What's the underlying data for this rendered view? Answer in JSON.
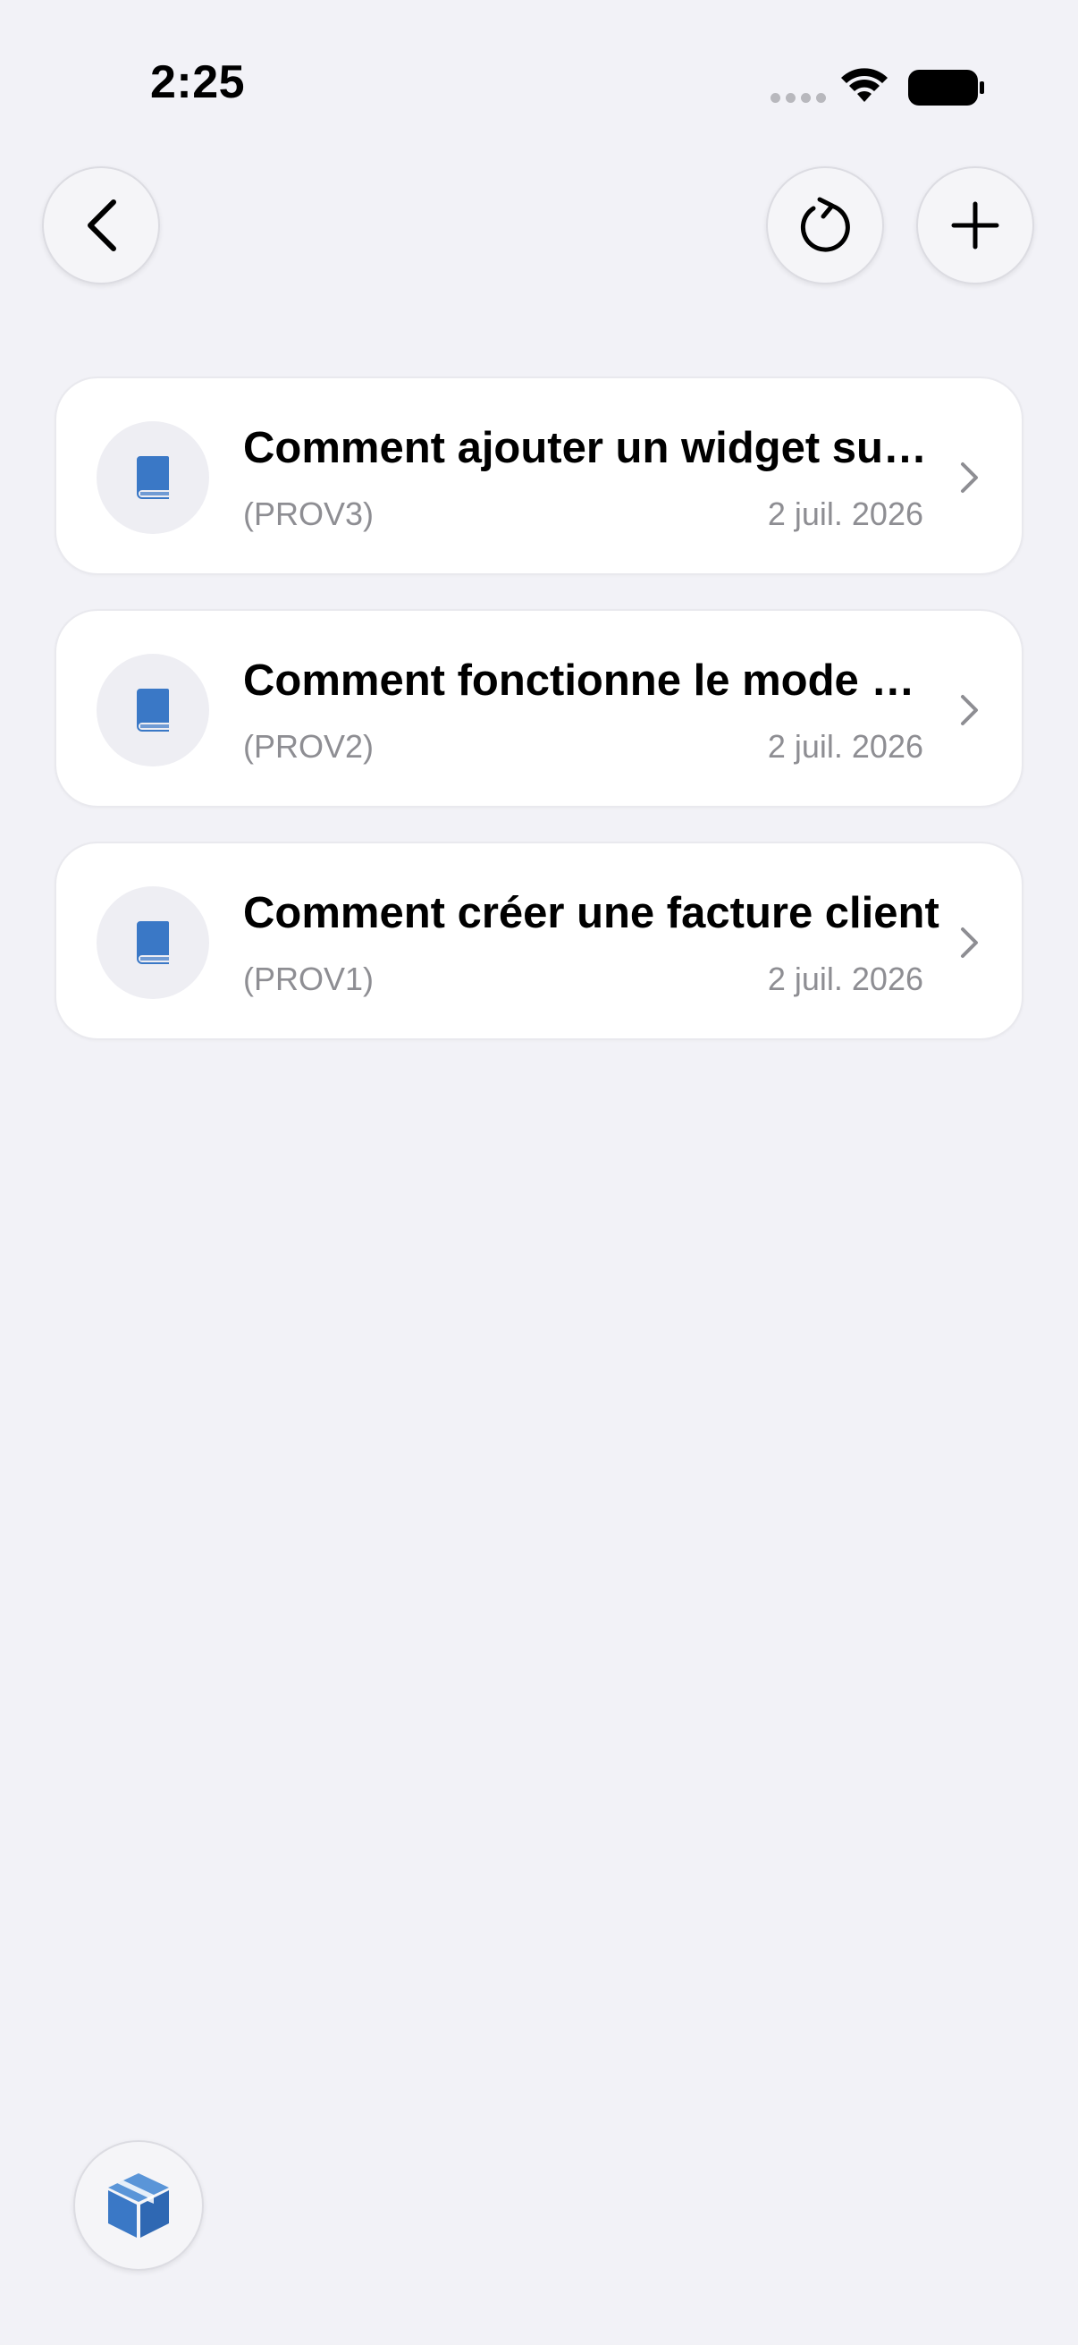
{
  "status_bar": {
    "time": "2:25",
    "icons": [
      "signal-dots-icon",
      "wifi-icon",
      "battery-icon"
    ]
  },
  "nav": {
    "back_icon": "chevron-left-icon",
    "refresh_icon": "refresh-icon",
    "add_icon": "plus-icon"
  },
  "items": [
    {
      "title": "Comment ajouter un widget sur l'écran d'accueil",
      "code": "(PROV3)",
      "date": "2 juil. 2026",
      "icon": "book-icon"
    },
    {
      "title": "Comment fonctionne le mode hors ligne",
      "code": "(PROV2)",
      "date": "2 juil. 2026",
      "icon": "book-icon"
    },
    {
      "title": "Comment créer une facture client",
      "code": "(PROV1)",
      "date": "2 juil. 2026",
      "icon": "book-icon"
    }
  ],
  "bottom_button": {
    "icon": "box-icon"
  },
  "colors": {
    "background": "#f2f2f7",
    "accent": "#3a78c6",
    "secondary_text": "#8e8e93"
  }
}
